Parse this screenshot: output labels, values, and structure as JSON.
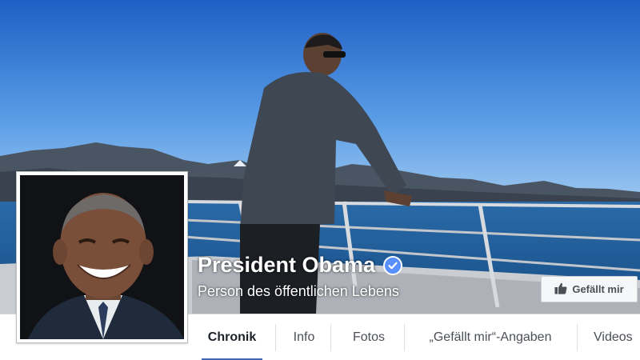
{
  "page": {
    "name": "President Obama",
    "category": "Person des öffentlichen Lebens",
    "verified": true
  },
  "actions": {
    "like_label": "Gefällt mir"
  },
  "tabs": [
    {
      "label": "Chronik",
      "active": true
    },
    {
      "label": "Info",
      "active": false
    },
    {
      "label": "Fotos",
      "active": false
    },
    {
      "label": "„Gefällt mir“-Angaben",
      "active": false
    },
    {
      "label": "Videos",
      "active": false
    }
  ],
  "icons": {
    "verified": "verified-badge-icon",
    "like": "thumbs-up-icon"
  },
  "colors": {
    "accent": "#4267b2",
    "verified": "#5890ff"
  }
}
